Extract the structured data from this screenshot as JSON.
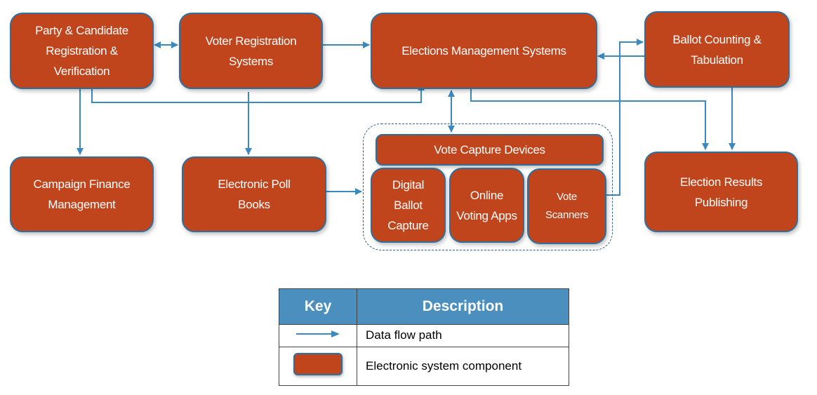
{
  "colors": {
    "component_fill": "#c0441c",
    "component_border": "#2f6f9c",
    "arrow": "#3a8abf",
    "key_header": "#4a8fbd"
  },
  "components": {
    "party": "Party & Candidate Registration & Verification",
    "voter_reg": "Voter Registration Systems",
    "ems": "Elections Management Systems",
    "ballot_counting": "Ballot Counting & Tabulation",
    "campaign_finance": "Campaign Finance Management",
    "poll_books": "Electronic Poll Books",
    "vote_capture": "Vote Capture Devices",
    "digital_ballot": "Digital Ballot Capture",
    "online_voting": "Online Voting Apps",
    "vote_scanners": "Vote Scanners",
    "results": "Election Results Publishing"
  },
  "key": {
    "header_key": "Key",
    "header_description": "Description",
    "rows": [
      {
        "icon": "arrow-icon",
        "description": "Data flow path"
      },
      {
        "icon": "component-swatch",
        "description": "Electronic system component"
      }
    ]
  }
}
